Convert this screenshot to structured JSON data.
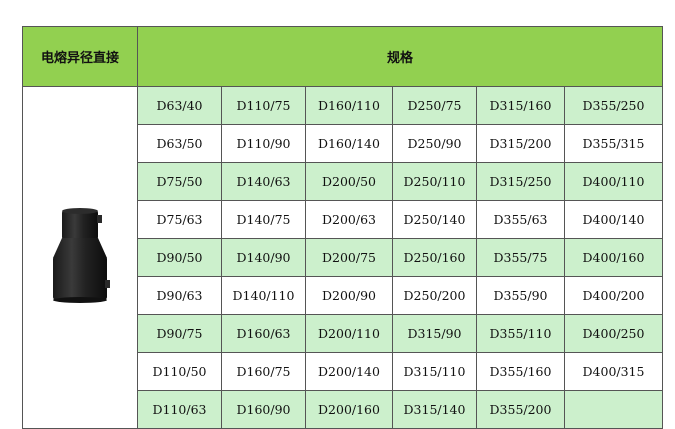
{
  "header": {
    "product_label": "电熔异径直接",
    "spec_label": "规格"
  },
  "product_image": {
    "icon": "electrofusion-reducer-coupler-photo"
  },
  "rows": [
    {
      "style": "green",
      "cells": [
        "D63/40",
        "D110/75",
        "D160/110",
        "D250/75",
        "D315/160",
        "D355/250"
      ]
    },
    {
      "style": "white",
      "cells": [
        "D63/50",
        "D110/90",
        "D160/140",
        "D250/90",
        "D315/200",
        "D355/315"
      ]
    },
    {
      "style": "green",
      "cells": [
        "D75/50",
        "D140/63",
        "D200/50",
        "D250/110",
        "D315/250",
        "D400/110"
      ]
    },
    {
      "style": "white",
      "cells": [
        "D75/63",
        "D140/75",
        "D200/63",
        "D250/140",
        "D355/63",
        "D400/140"
      ]
    },
    {
      "style": "green",
      "cells": [
        "D90/50",
        "D140/90",
        "D200/75",
        "D250/160",
        "D355/75",
        "D400/160"
      ]
    },
    {
      "style": "white",
      "cells": [
        "D90/63",
        "D140/110",
        "D200/90",
        "D250/200",
        "D355/90",
        "D400/200"
      ]
    },
    {
      "style": "green",
      "cells": [
        "D90/75",
        "D160/63",
        "D200/110",
        "D315/90",
        "D355/110",
        "D400/250"
      ]
    },
    {
      "style": "white",
      "cells": [
        "D110/50",
        "D160/75",
        "D200/140",
        "D315/110",
        "D355/160",
        "D400/315"
      ]
    },
    {
      "style": "green",
      "cells": [
        "D110/63",
        "D160/90",
        "D200/160",
        "D315/140",
        "D355/200",
        ""
      ]
    }
  ],
  "colors": {
    "header_green": "#92d050",
    "row_green": "#ccf0cc",
    "border": "#555555"
  }
}
